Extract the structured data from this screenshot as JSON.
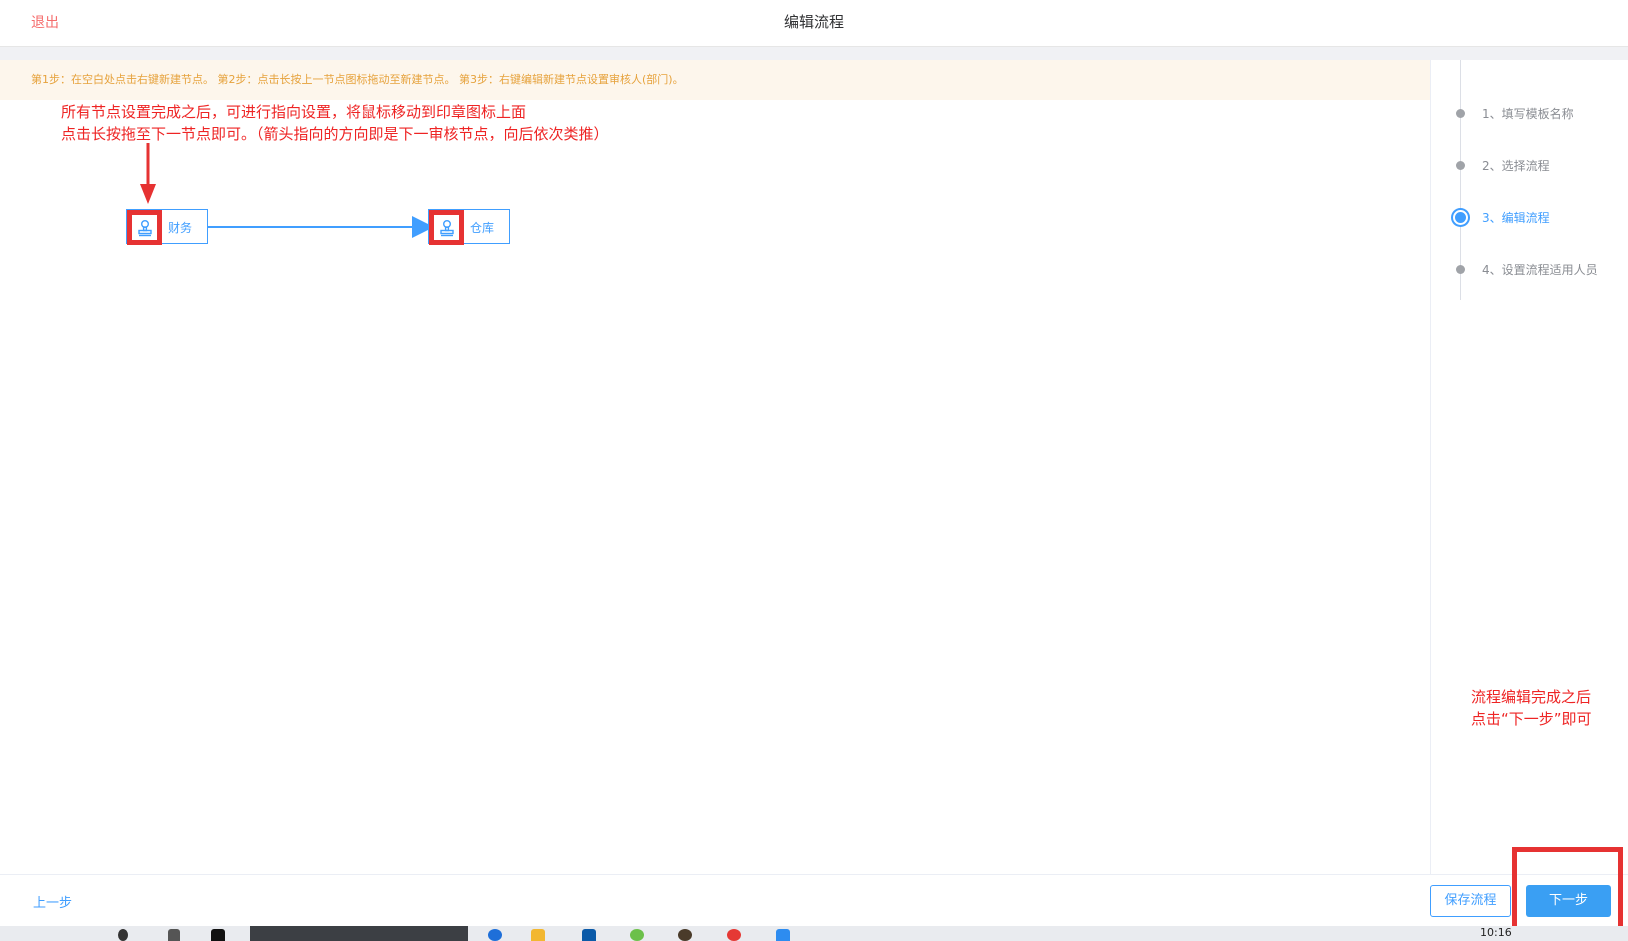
{
  "header": {
    "exit_label": "退出",
    "title": "编辑流程"
  },
  "tip": "第1步：在空白处点击右键新建节点。 第2步：点击长按上一节点图标拖动至新建节点。 第3步：右键编辑新建节点设置审核人(部门)。",
  "annotation_top": {
    "line1": "所有节点设置完成之后，可进行指向设置，将鼠标移动到印章图标上面",
    "line2": "点击长按拖至下一节点即可。（箭头指向的方向即是下一审核节点，向后依次类推）"
  },
  "flow": {
    "nodes": [
      {
        "name": "财务",
        "icon": "stamp-icon"
      },
      {
        "name": "仓库",
        "icon": "stamp-icon"
      }
    ]
  },
  "steps": [
    {
      "label": "1、填写模板名称",
      "active": false
    },
    {
      "label": "2、选择流程",
      "active": false
    },
    {
      "label": "3、编辑流程",
      "active": true
    },
    {
      "label": "4、设置流程适用人员",
      "active": false
    }
  ],
  "annotation_bottom": {
    "line1": "流程编辑完成之后",
    "line2": "点击“下一步”即可"
  },
  "footer": {
    "prev_label": "上一步",
    "save_label": "保存流程",
    "next_label": "下一步"
  },
  "taskbar": {
    "time": "10:16"
  },
  "colors": {
    "primary": "#409eff",
    "annotation": "#ee2424",
    "tip_bg": "#fdf6ec",
    "tip_text": "#e6a23c"
  }
}
